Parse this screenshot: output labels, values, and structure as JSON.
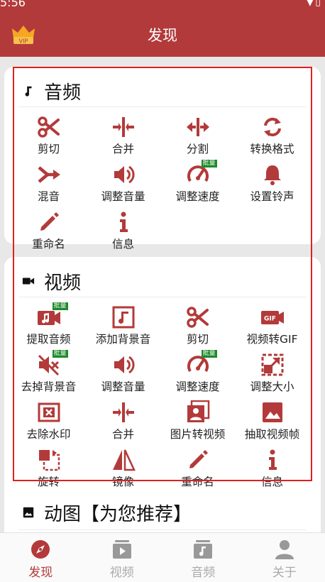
{
  "status_bar": {
    "time": "5:56",
    "icons": [
      "wifi-icon",
      "battery-icon"
    ]
  },
  "app_bar": {
    "title": "发现",
    "vip_label": "VIP"
  },
  "colors": {
    "primary": "#b33a3a",
    "badge": "#1e8a2a",
    "highlight": "#e02020"
  },
  "audio_section": {
    "title": "音频",
    "items": [
      {
        "label": "剪切",
        "icon": "scissors-icon"
      },
      {
        "label": "合并",
        "icon": "merge-icon"
      },
      {
        "label": "分割",
        "icon": "split-icon"
      },
      {
        "label": "转换格式",
        "icon": "convert-icon"
      },
      {
        "label": "混音",
        "icon": "mix-icon"
      },
      {
        "label": "调整音量",
        "icon": "volume-icon"
      },
      {
        "label": "调整速度",
        "icon": "speed-icon",
        "badge": "批量"
      },
      {
        "label": "设置铃声",
        "icon": "bell-icon"
      },
      {
        "label": "重命名",
        "icon": "pencil-icon"
      },
      {
        "label": "信息",
        "icon": "info-icon"
      }
    ]
  },
  "video_section": {
    "title": "视频",
    "items": [
      {
        "label": "提取音频",
        "icon": "extract-audio-icon",
        "badge": "批量"
      },
      {
        "label": "添加背景音",
        "icon": "add-music-icon"
      },
      {
        "label": "剪切",
        "icon": "scissors-icon"
      },
      {
        "label": "视频转GIF",
        "icon": "gif-icon",
        "icon_text": "GIF"
      },
      {
        "label": "去掉背景音",
        "icon": "mute-icon",
        "badge": "批量"
      },
      {
        "label": "调整音量",
        "icon": "volume-icon"
      },
      {
        "label": "调整速度",
        "icon": "speed-icon",
        "badge": "批量"
      },
      {
        "label": "调整大小",
        "icon": "resize-icon"
      },
      {
        "label": "去除水印",
        "icon": "watermark-icon"
      },
      {
        "label": "合并",
        "icon": "merge-icon"
      },
      {
        "label": "图片转视频",
        "icon": "photos-icon"
      },
      {
        "label": "抽取视频帧",
        "icon": "image-icon"
      },
      {
        "label": "旋转",
        "icon": "rotate-icon"
      },
      {
        "label": "镜像",
        "icon": "mirror-icon"
      },
      {
        "label": "重命名",
        "icon": "pencil-icon"
      },
      {
        "label": "信息",
        "icon": "info-icon"
      }
    ]
  },
  "gif_section": {
    "title": "动图【为您推荐】"
  },
  "bottom_nav": [
    {
      "label": "发现",
      "icon": "compass-icon",
      "active": true
    },
    {
      "label": "视频",
      "icon": "video-folder-icon",
      "active": false
    },
    {
      "label": "音频",
      "icon": "music-folder-icon",
      "active": false
    },
    {
      "label": "关于",
      "icon": "person-icon",
      "active": false
    }
  ]
}
